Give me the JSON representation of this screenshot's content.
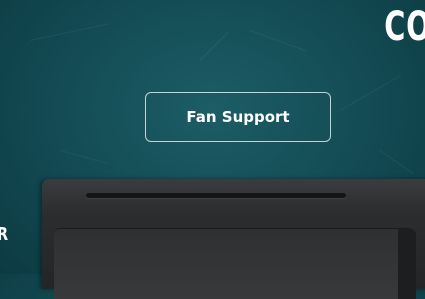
{
  "header": {
    "brand_partial": "CO"
  },
  "hero": {
    "fan_support_label": "Fan Support",
    "left_edge_partial": "R"
  },
  "colors": {
    "background": "#134a53",
    "button_border": "#ffffff",
    "device": "#2b2d2f"
  }
}
